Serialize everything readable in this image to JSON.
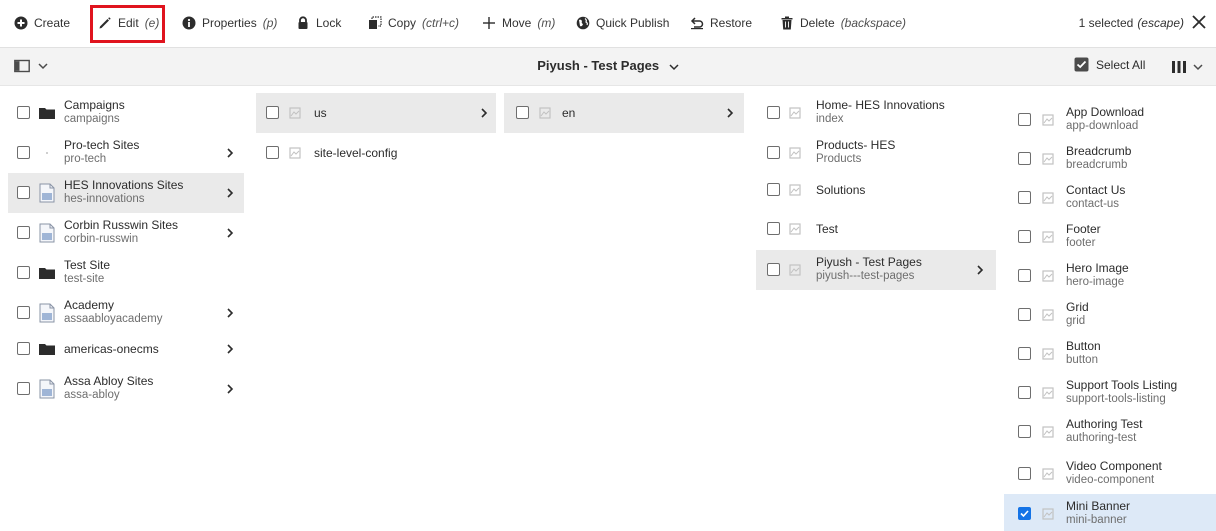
{
  "actionbar": {
    "create": "Create",
    "edit": "Edit",
    "edit_key": "(e)",
    "properties": "Properties",
    "properties_key": "(p)",
    "lock": "Lock",
    "copy": "Copy",
    "copy_key": "(ctrl+c)",
    "move": "Move",
    "move_key": "(m)",
    "quick_publish": "Quick Publish",
    "restore": "Restore",
    "delete": "Delete",
    "delete_key": "(backspace)",
    "selected": "1 selected",
    "selected_key": "(escape)"
  },
  "titlebar": {
    "title": "Piyush - Test Pages",
    "select_all": "Select All"
  },
  "columns": {
    "col1": [
      {
        "title": "Campaigns",
        "name": "campaigns",
        "icon": "folder-icon"
      },
      {
        "title": "Pro-tech Sites",
        "name": "pro-tech",
        "icon": "blank-icon"
      },
      {
        "title": "HES Innovations Sites",
        "name": "hes-innovations",
        "icon": "page-icon"
      },
      {
        "title": "Corbin Russwin Sites",
        "name": "corbin-russwin",
        "icon": "page-icon"
      },
      {
        "title": "Test Site",
        "name": "test-site",
        "icon": "folder-icon"
      },
      {
        "title": "Academy",
        "name": "assaabloyacademy",
        "icon": "page-icon"
      },
      {
        "title": "americas-onecms",
        "name": "",
        "icon": "folder-icon"
      },
      {
        "title": "Assa Abloy Sites",
        "name": "assa-abloy",
        "icon": "page-icon"
      }
    ],
    "col2": [
      {
        "title": "us",
        "name": "",
        "icon": "image-placeholder-icon"
      },
      {
        "title": "site-level-config",
        "name": "",
        "icon": "image-placeholder-icon"
      }
    ],
    "col3": [
      {
        "title": "en",
        "name": "",
        "icon": "image-placeholder-icon"
      }
    ],
    "col4": [
      {
        "title": "Home- HES Innovations",
        "name": "index",
        "icon": "image-placeholder-icon"
      },
      {
        "title": "Products- HES",
        "name": "Products",
        "icon": "image-placeholder-icon"
      },
      {
        "title": "Solutions",
        "name": "",
        "icon": "image-placeholder-icon"
      },
      {
        "title": "Test",
        "name": "",
        "icon": "image-placeholder-icon"
      },
      {
        "title": "Piyush - Test Pages",
        "name": "piyush---test-pages",
        "icon": "image-placeholder-icon"
      }
    ],
    "col5": [
      {
        "title": "App Download",
        "name": "app-download",
        "icon": "image-placeholder-icon"
      },
      {
        "title": "Breadcrumb",
        "name": "breadcrumb",
        "icon": "image-placeholder-icon"
      },
      {
        "title": "Contact Us",
        "name": "contact-us",
        "icon": "image-placeholder-icon"
      },
      {
        "title": "Footer",
        "name": "footer",
        "icon": "image-placeholder-icon"
      },
      {
        "title": "Hero Image",
        "name": "hero-image",
        "icon": "image-placeholder-icon"
      },
      {
        "title": "Grid",
        "name": "grid",
        "icon": "image-placeholder-icon"
      },
      {
        "title": "Button",
        "name": "button",
        "icon": "image-placeholder-icon"
      },
      {
        "title": "Support Tools Listing",
        "name": "support-tools-listing",
        "icon": "image-placeholder-icon"
      },
      {
        "title": "Authoring Test",
        "name": "authoring-test",
        "icon": "image-placeholder-icon"
      },
      {
        "title": "Video Component",
        "name": "video-component",
        "icon": "image-placeholder-icon"
      },
      {
        "title": "Mini Banner",
        "name": "mini-banner",
        "icon": "image-placeholder-icon"
      }
    ]
  },
  "colors": {
    "highlight": "#e0141e",
    "checkbox_on": "#1473e6",
    "selected_row": "#dde9f7",
    "active_row": "#eaeaea"
  }
}
